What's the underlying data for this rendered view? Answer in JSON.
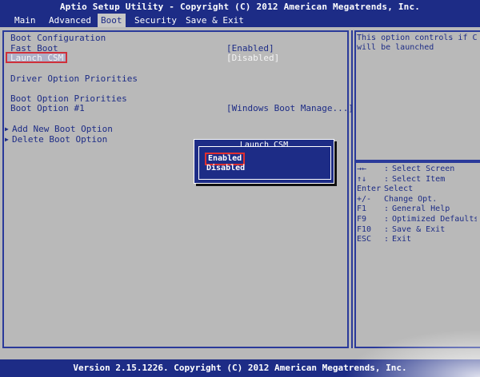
{
  "title": "Aptio Setup Utility - Copyright (C) 2012 American Megatrends, Inc.",
  "tabs": [
    "Main",
    "Advanced",
    "Boot",
    "Security",
    "Save & Exit"
  ],
  "active_tab": "Boot",
  "items": {
    "boot_configuration": "Boot Configuration",
    "fast_boot_label": "Fast Boot",
    "fast_boot_value": "[Enabled]",
    "launch_csm_label": "Launch CSM",
    "launch_csm_value": "[Disabled]",
    "driver_option_priorities": "Driver Option Priorities",
    "boot_option_priorities": "Boot Option Priorities",
    "boot_option_1_label": "Boot Option #1",
    "boot_option_1_value": "[Windows Boot Manage...]",
    "add_new_boot_option": "Add New Boot Option",
    "delete_boot_option": "Delete Boot Option"
  },
  "help_text": "This option controls if C\nwill be launched",
  "keys": [
    {
      "key": "→←",
      "desc": "Select Screen"
    },
    {
      "key": "↑↓",
      "desc": "Select Item"
    },
    {
      "key": "Enter",
      "desc": "Select"
    },
    {
      "key": "+/-",
      "desc": "Change Opt."
    },
    {
      "key": "F1",
      "desc": "General Help"
    },
    {
      "key": "F9",
      "desc": "Optimized Defaults"
    },
    {
      "key": "F10",
      "desc": "Save & Exit"
    },
    {
      "key": "ESC",
      "desc": "Exit"
    }
  ],
  "popup": {
    "title": "Launch CSM",
    "options": [
      "Enabled",
      "Disabled"
    ],
    "selected": "Enabled"
  },
  "footer": "Version 2.15.1226. Copyright (C) 2012 American Megatrends, Inc.",
  "colors": {
    "bios_blue": "#1d2c86",
    "background_gray": "#b9b9b9",
    "highlight_red": "#d0303a",
    "text_white": "#ffffff"
  }
}
